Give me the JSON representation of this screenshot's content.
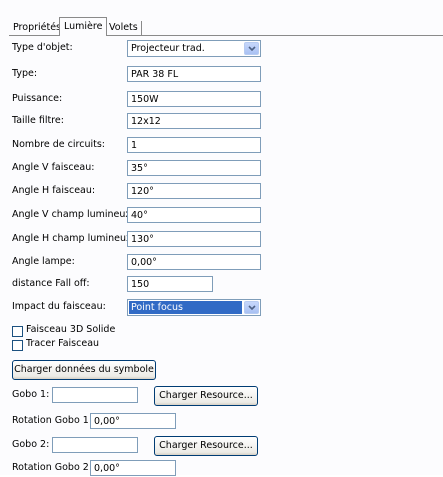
{
  "tabs": [
    "Propriétés",
    "Lumière",
    "Volets"
  ],
  "selected_tab": "Lumière",
  "rows": [
    {
      "label": "Type d'objet:",
      "value": "Projecteur trad.",
      "kind": "select"
    },
    {
      "label": "Type:",
      "value": "PAR 38 FL",
      "kind": "text"
    },
    {
      "label": "Puissance:",
      "value": "150W",
      "kind": "text"
    },
    {
      "label": "Taille filtre:",
      "value": "12x12",
      "kind": "text"
    },
    {
      "label": "Nombre de circuits:",
      "value": "1",
      "kind": "text"
    },
    {
      "label": "Angle V faisceau:",
      "value": "35°",
      "kind": "text"
    },
    {
      "label": "Angle H faisceau:",
      "value": "120°",
      "kind": "text"
    },
    {
      "label": "Angle V champ lumineux:",
      "value": "40°",
      "kind": "text"
    },
    {
      "label": "Angle H champ lumineux:",
      "value": "130°",
      "kind": "text"
    },
    {
      "label": "Angle lampe:",
      "value": "0,00°",
      "kind": "text"
    },
    {
      "label": "distance Fall off:",
      "value": "150",
      "kind": "text"
    },
    {
      "label": "Impact du faisceau:",
      "value": "Point focus",
      "kind": "select"
    }
  ],
  "checkboxes": [
    {
      "label": "Faisceau 3D Solide",
      "checked": false
    },
    {
      "label": "Tracer Faisceau",
      "checked": false
    }
  ],
  "load_symbol_button": "Charger données du symbole",
  "gobo1": {
    "label": "Gobo 1:",
    "value": "",
    "button": "Charger Resource..."
  },
  "rotation_gobo1": {
    "label": "Rotation Gobo 1:",
    "value": "0,00°"
  },
  "gobo2": {
    "label": "Gobo 2:",
    "value": "",
    "button": "Charger Resource..."
  },
  "rotation_gobo2": {
    "label": "Rotation Gobo 2:",
    "value": "0,00°"
  },
  "colors": {
    "accent": "#316ac5",
    "field_border": "#7f9db9",
    "button_border": "#003c74"
  },
  "icons": {
    "dropdown": "chevron-down-icon",
    "checkbox": "checkbox-icon"
  }
}
